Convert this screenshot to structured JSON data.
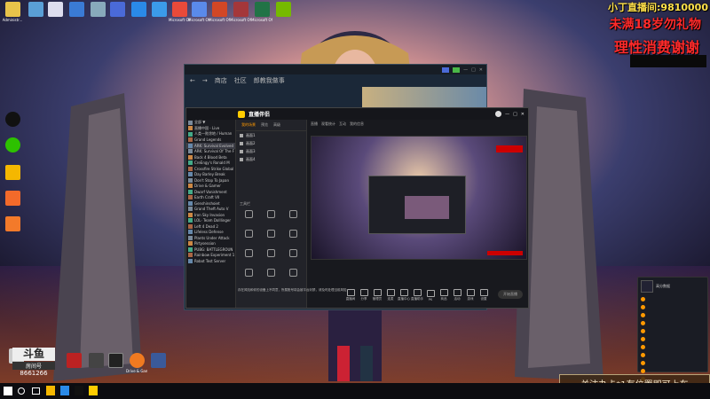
{
  "desktop": {
    "icons": [
      "Administr...",
      "",
      "",
      "",
      "",
      "",
      "",
      "",
      "Microsoft Office Po...",
      "Microsoft Office Ac...",
      "Microsoft Office Exc...",
      "",
      "",
      "",
      "",
      "",
      "",
      "",
      "",
      ""
    ],
    "bottom_icons": [
      "",
      "",
      "",
      "",
      "Drive & Gamer",
      "",
      "",
      ""
    ]
  },
  "stream": {
    "room": "小丁直播间:9810000",
    "line1": "未满18岁勿礼物",
    "line2": "理性消费谢谢"
  },
  "watermark": {
    "room_label": "房间号",
    "room_id": "8661266"
  },
  "steam": {
    "nav": [
      "商店",
      "社区",
      "郎教我做事"
    ]
  },
  "obs": {
    "title": "直播伴侣",
    "scene_tabs": [
      "我的场景",
      "预览",
      "高级"
    ],
    "games": [
      "全部 ▼",
      "直播中国 - Live",
      "人类一败涂地 / Human",
      "Grand Legends",
      "ARK: Survival Evolved",
      "ARK: Survival Of The F",
      "Back 4 Blood Beta",
      "CreEngy's Ronald M",
      "Crossfire Strike Global",
      "Day Barley Break",
      "Don't Stop To Japan",
      "Drive & Gamer",
      "Dwarf Vanishment",
      "Earth Craft VII",
      "Genshinshoiet",
      "Grand Theft Auto V",
      "Iron Sky Invasion",
      "LOL· Team Dolllinger",
      "Left 4 Dead 2",
      "Lifeless Defense",
      "Plants Under Attack",
      "Pirtysession",
      "PUBG: BATTLEGROUN",
      "Rainbow Experiment 1",
      "Robot Test Server"
    ],
    "scenes": [
      "画面1",
      "画面2",
      "画面3",
      "画面4"
    ],
    "tools": [
      "工具栏",
      "",
      "",
      "",
      "",
      "",
      "",
      "",
      "",
      "",
      "",
      "",
      ""
    ],
    "notice": "存在风险和你的设备上不同意，所属账号将会被平台封禁，请及时处理当前风险",
    "stream_tabs": [
      "直播",
      "观看统计",
      "互动",
      "我的信息"
    ],
    "bottom_tools": [
      "直播间",
      "分享",
      "管理员",
      "连麦",
      "直播中心",
      "直播助手",
      "PK",
      "商品",
      "活动",
      "游戏",
      "设置"
    ],
    "start_button": "开始直播"
  },
  "rank": {
    "title": "高分数据",
    "rows": [
      "",
      "",
      "",
      "",
      "",
      "",
      "",
      "",
      "",
      "",
      ""
    ]
  },
  "danmu": "关注办卡*1有位置即可上车"
}
